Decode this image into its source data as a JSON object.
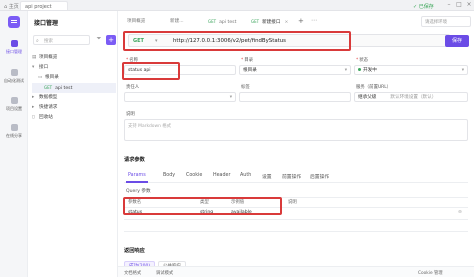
{
  "topbar": {
    "home_label": "主页",
    "project_tab": "api project",
    "sync_status": "✓ 已保存"
  },
  "rail": {
    "items": [
      {
        "label": "接口管理"
      },
      {
        "label": "自动化测试"
      },
      {
        "label": "项目设置"
      },
      {
        "label": "在线分享"
      }
    ]
  },
  "sidebar": {
    "title": "接口管理",
    "search_placeholder": "搜索",
    "tree": [
      {
        "label": "项目概览"
      },
      {
        "label": "接口"
      },
      {
        "label": "根目录"
      },
      {
        "method": "GET",
        "label": "api test"
      },
      {
        "label": "数据模型"
      },
      {
        "label": "快捷请求"
      },
      {
        "label": "回收站"
      }
    ]
  },
  "tabs": {
    "items": [
      {
        "label": "项目概览"
      },
      {
        "label": "新建..."
      },
      {
        "method": "GET",
        "label": "api test"
      },
      {
        "method": "GET",
        "label": "新建接口"
      }
    ],
    "env_placeholder": "请选择环境"
  },
  "request": {
    "method": "GET",
    "url": "http://127.0.0.1:3006/v2/pet/findByStatus",
    "save_label": "保存"
  },
  "form": {
    "name_label": "名称",
    "name_value": "status api",
    "dir_label": "目录",
    "dir_value": "根目录",
    "status_label": "状态",
    "status_value": "开发中",
    "owner_label": "责任人",
    "tag_label": "标签",
    "service_label": "服务（前置URL）",
    "service_value": "继承父级",
    "service_hint": "默认环境设置（默认）",
    "desc_label": "说明",
    "desc_placeholder": "支持 Markdown 格式"
  },
  "params": {
    "section_title": "请求参数",
    "tabs": [
      "Params",
      "Body",
      "Cookie",
      "Header",
      "Auth",
      "设置",
      "前置操作",
      "后置操作"
    ],
    "query_label": "Query 参数",
    "headers": [
      "参数名",
      "类型",
      "示例值",
      "说明"
    ],
    "rows": [
      {
        "name": "status",
        "type": "string",
        "example": "available"
      }
    ]
  },
  "response": {
    "section_title": "返回响应",
    "tabs": [
      "成功(200)",
      "公共响应"
    ]
  },
  "bottombar": {
    "items": [
      "文档格式",
      "调试模式",
      "Cookie 管理"
    ]
  }
}
